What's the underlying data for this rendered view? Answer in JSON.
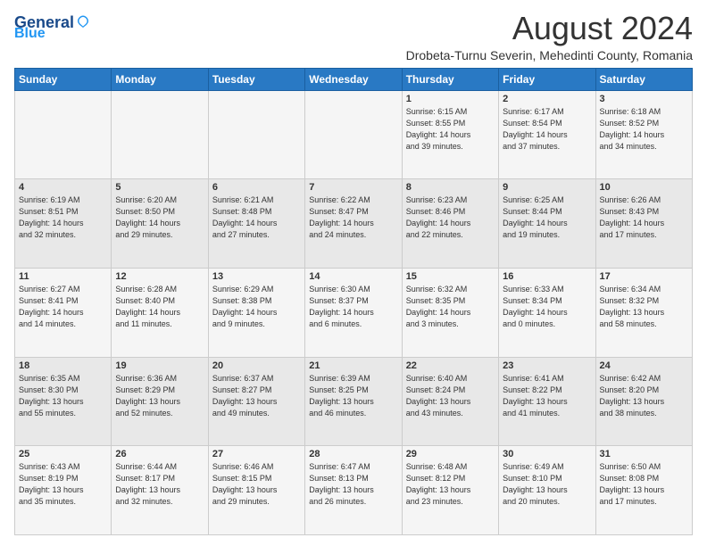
{
  "header": {
    "logo_general": "General",
    "logo_blue": "Blue",
    "month_title": "August 2024",
    "subtitle": "Drobeta-Turnu Severin, Mehedinti County, Romania"
  },
  "weekdays": [
    "Sunday",
    "Monday",
    "Tuesday",
    "Wednesday",
    "Thursday",
    "Friday",
    "Saturday"
  ],
  "weeks": [
    [
      {
        "day": "",
        "info": ""
      },
      {
        "day": "",
        "info": ""
      },
      {
        "day": "",
        "info": ""
      },
      {
        "day": "",
        "info": ""
      },
      {
        "day": "1",
        "info": "Sunrise: 6:15 AM\nSunset: 8:55 PM\nDaylight: 14 hours\nand 39 minutes."
      },
      {
        "day": "2",
        "info": "Sunrise: 6:17 AM\nSunset: 8:54 PM\nDaylight: 14 hours\nand 37 minutes."
      },
      {
        "day": "3",
        "info": "Sunrise: 6:18 AM\nSunset: 8:52 PM\nDaylight: 14 hours\nand 34 minutes."
      }
    ],
    [
      {
        "day": "4",
        "info": "Sunrise: 6:19 AM\nSunset: 8:51 PM\nDaylight: 14 hours\nand 32 minutes."
      },
      {
        "day": "5",
        "info": "Sunrise: 6:20 AM\nSunset: 8:50 PM\nDaylight: 14 hours\nand 29 minutes."
      },
      {
        "day": "6",
        "info": "Sunrise: 6:21 AM\nSunset: 8:48 PM\nDaylight: 14 hours\nand 27 minutes."
      },
      {
        "day": "7",
        "info": "Sunrise: 6:22 AM\nSunset: 8:47 PM\nDaylight: 14 hours\nand 24 minutes."
      },
      {
        "day": "8",
        "info": "Sunrise: 6:23 AM\nSunset: 8:46 PM\nDaylight: 14 hours\nand 22 minutes."
      },
      {
        "day": "9",
        "info": "Sunrise: 6:25 AM\nSunset: 8:44 PM\nDaylight: 14 hours\nand 19 minutes."
      },
      {
        "day": "10",
        "info": "Sunrise: 6:26 AM\nSunset: 8:43 PM\nDaylight: 14 hours\nand 17 minutes."
      }
    ],
    [
      {
        "day": "11",
        "info": "Sunrise: 6:27 AM\nSunset: 8:41 PM\nDaylight: 14 hours\nand 14 minutes."
      },
      {
        "day": "12",
        "info": "Sunrise: 6:28 AM\nSunset: 8:40 PM\nDaylight: 14 hours\nand 11 minutes."
      },
      {
        "day": "13",
        "info": "Sunrise: 6:29 AM\nSunset: 8:38 PM\nDaylight: 14 hours\nand 9 minutes."
      },
      {
        "day": "14",
        "info": "Sunrise: 6:30 AM\nSunset: 8:37 PM\nDaylight: 14 hours\nand 6 minutes."
      },
      {
        "day": "15",
        "info": "Sunrise: 6:32 AM\nSunset: 8:35 PM\nDaylight: 14 hours\nand 3 minutes."
      },
      {
        "day": "16",
        "info": "Sunrise: 6:33 AM\nSunset: 8:34 PM\nDaylight: 14 hours\nand 0 minutes."
      },
      {
        "day": "17",
        "info": "Sunrise: 6:34 AM\nSunset: 8:32 PM\nDaylight: 13 hours\nand 58 minutes."
      }
    ],
    [
      {
        "day": "18",
        "info": "Sunrise: 6:35 AM\nSunset: 8:30 PM\nDaylight: 13 hours\nand 55 minutes."
      },
      {
        "day": "19",
        "info": "Sunrise: 6:36 AM\nSunset: 8:29 PM\nDaylight: 13 hours\nand 52 minutes."
      },
      {
        "day": "20",
        "info": "Sunrise: 6:37 AM\nSunset: 8:27 PM\nDaylight: 13 hours\nand 49 minutes."
      },
      {
        "day": "21",
        "info": "Sunrise: 6:39 AM\nSunset: 8:25 PM\nDaylight: 13 hours\nand 46 minutes."
      },
      {
        "day": "22",
        "info": "Sunrise: 6:40 AM\nSunset: 8:24 PM\nDaylight: 13 hours\nand 43 minutes."
      },
      {
        "day": "23",
        "info": "Sunrise: 6:41 AM\nSunset: 8:22 PM\nDaylight: 13 hours\nand 41 minutes."
      },
      {
        "day": "24",
        "info": "Sunrise: 6:42 AM\nSunset: 8:20 PM\nDaylight: 13 hours\nand 38 minutes."
      }
    ],
    [
      {
        "day": "25",
        "info": "Sunrise: 6:43 AM\nSunset: 8:19 PM\nDaylight: 13 hours\nand 35 minutes."
      },
      {
        "day": "26",
        "info": "Sunrise: 6:44 AM\nSunset: 8:17 PM\nDaylight: 13 hours\nand 32 minutes."
      },
      {
        "day": "27",
        "info": "Sunrise: 6:46 AM\nSunset: 8:15 PM\nDaylight: 13 hours\nand 29 minutes."
      },
      {
        "day": "28",
        "info": "Sunrise: 6:47 AM\nSunset: 8:13 PM\nDaylight: 13 hours\nand 26 minutes."
      },
      {
        "day": "29",
        "info": "Sunrise: 6:48 AM\nSunset: 8:12 PM\nDaylight: 13 hours\nand 23 minutes."
      },
      {
        "day": "30",
        "info": "Sunrise: 6:49 AM\nSunset: 8:10 PM\nDaylight: 13 hours\nand 20 minutes."
      },
      {
        "day": "31",
        "info": "Sunrise: 6:50 AM\nSunset: 8:08 PM\nDaylight: 13 hours\nand 17 minutes."
      }
    ]
  ]
}
